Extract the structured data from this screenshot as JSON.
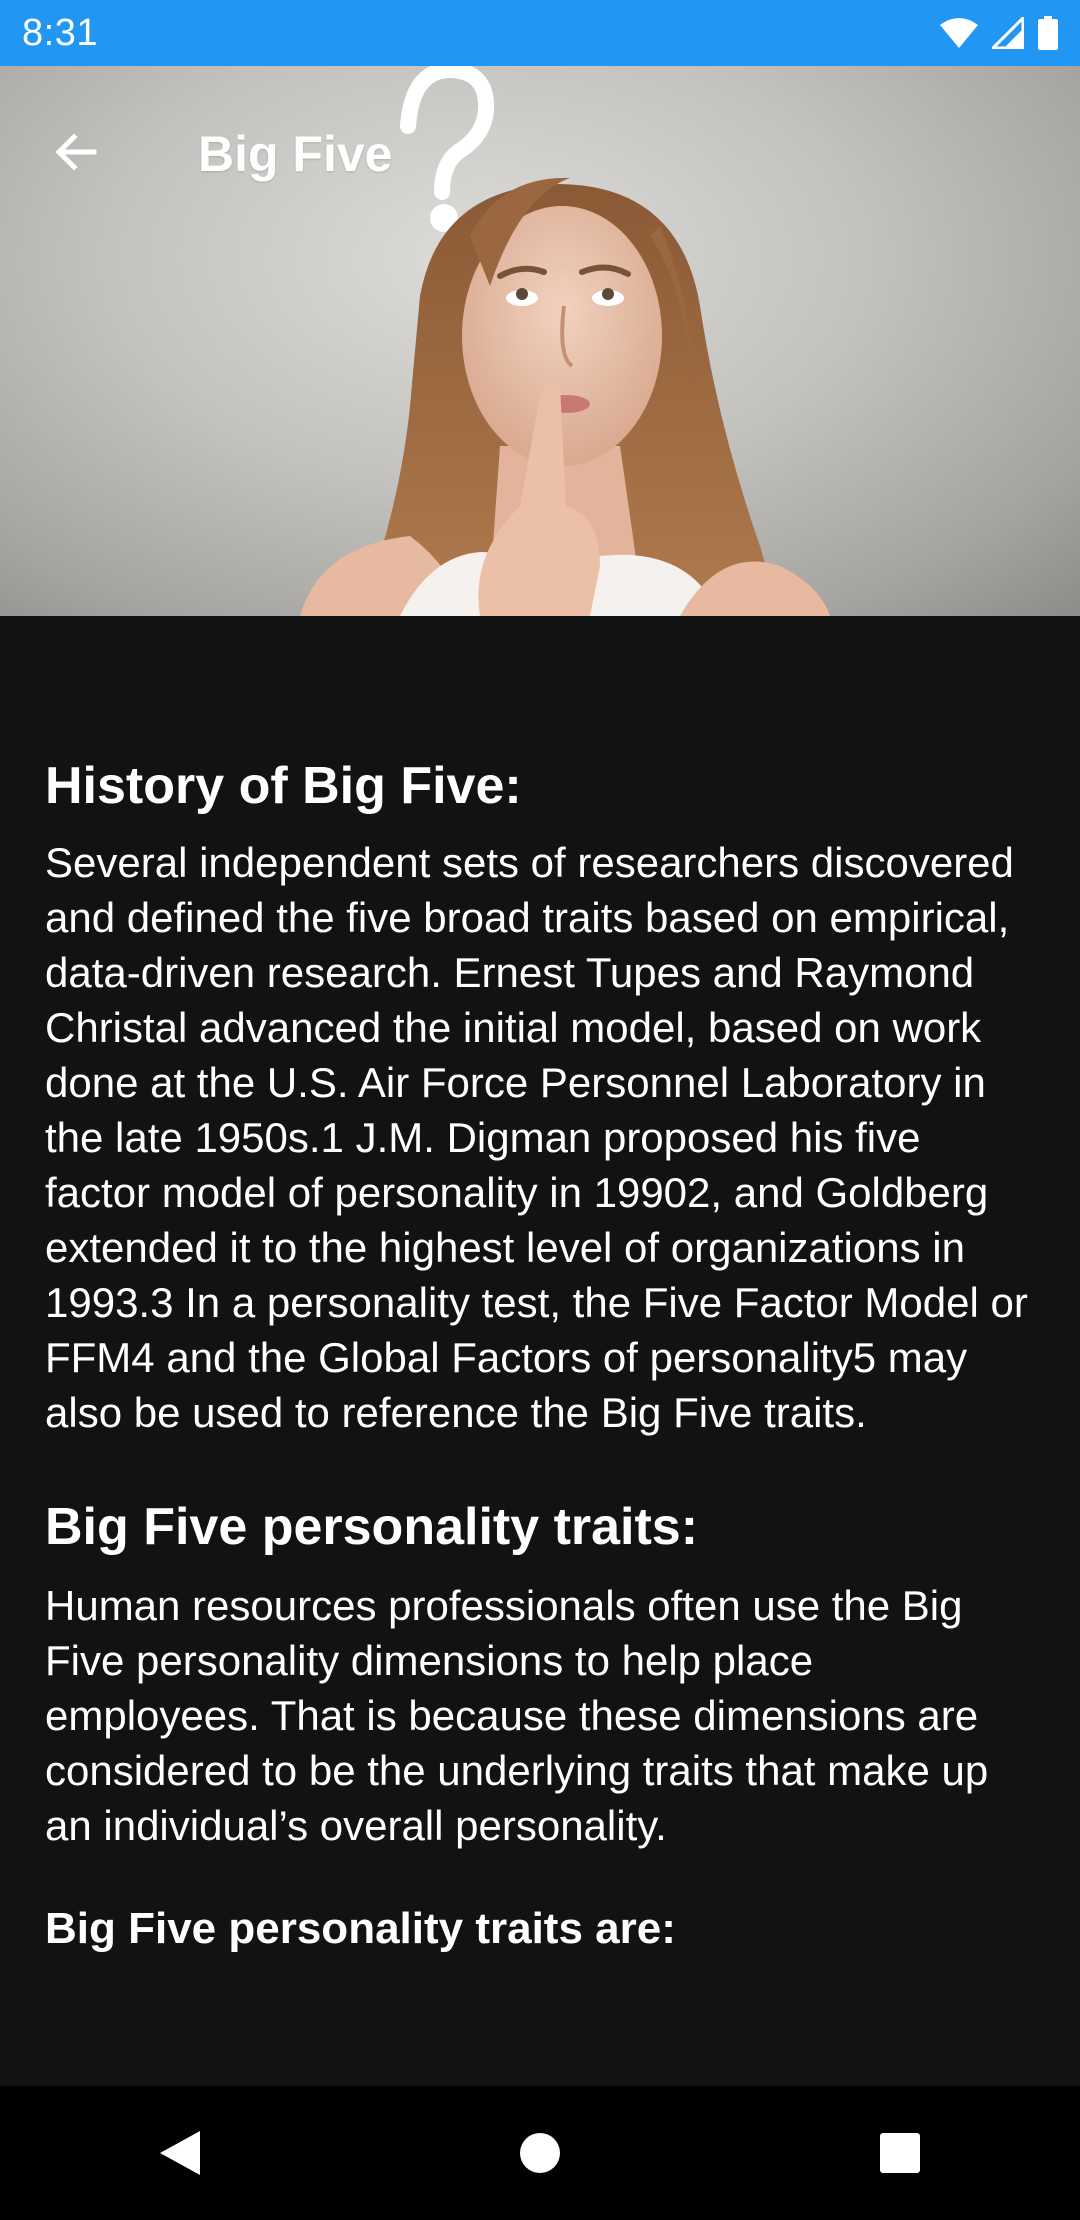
{
  "status_bar": {
    "time": "8:31",
    "icons": [
      "wifi-icon",
      "cell-signal-icon",
      "battery-icon"
    ]
  },
  "header": {
    "title": "Big Five",
    "back_icon": "arrow-back-icon"
  },
  "sections": [
    {
      "heading": "History of Big Five:",
      "body": "Several independent sets of researchers discovered and defined the five broad traits based on empirical, data-driven research. Ernest Tupes and Raymond Christal advanced the initial model, based on work done at the U.S. Air Force Personnel Laboratory in the late 1950s.1 J.M. Digman proposed his five factor model of personality in 19902, and Goldberg extended it to the highest level of organizations in 1993.3 In a personality test, the Five Factor Model or FFM4 and the Global Factors of personality5 may also be used to reference the Big Five traits."
    },
    {
      "heading": "Big Five personality traits:",
      "body": "Human resources professionals often use the Big Five personality dimensions to help place employees. That is because these dimensions are considered to be the underlying traits that make up an individual’s overall personality."
    }
  ],
  "sub_heading": "Big Five personality traits are:",
  "nav_bar": {
    "buttons": [
      "back-triangle-icon",
      "home-circle-icon",
      "recents-square-icon"
    ]
  },
  "colors": {
    "status_bar": "#2196F3",
    "background": "#121212",
    "text": "#FFFFFF",
    "nav_bar": "#000000"
  }
}
